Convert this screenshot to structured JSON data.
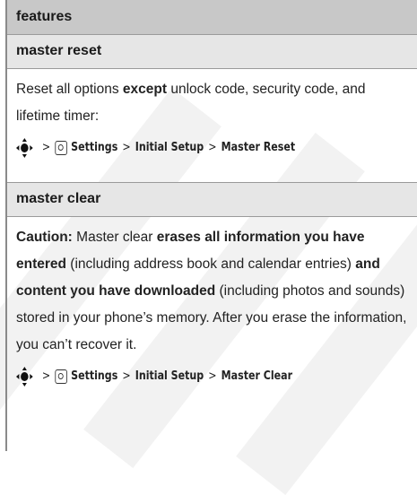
{
  "header": {
    "title": "features"
  },
  "sections": [
    {
      "title": "master reset",
      "body": [
        {
          "text": "Reset all options ",
          "bold": false
        },
        {
          "text": "except",
          "bold": true
        },
        {
          "text": " unlock code, security code, and lifetime timer:",
          "bold": false
        }
      ],
      "path": [
        "Settings",
        "Initial Setup",
        "Master Reset"
      ]
    },
    {
      "title": "master clear",
      "body": [
        {
          "text": "Caution:",
          "bold": true
        },
        {
          "text": " Master clear ",
          "bold": false
        },
        {
          "text": "erases all information you have entered",
          "bold": true
        },
        {
          "text": " (including address book and calendar entries) ",
          "bold": false
        },
        {
          "text": "and content you have downloaded",
          "bold": true
        },
        {
          "text": " (including photos and sounds) stored in your phone’s memory. After you erase the information, you can’t recover it.",
          "bold": false
        }
      ],
      "path": [
        "Settings",
        "Initial Setup",
        "Master Clear"
      ]
    }
  ],
  "symbols": {
    "separator": ">"
  },
  "icons": {
    "nav": "navigation-key-icon",
    "settings": "settings-icon"
  }
}
